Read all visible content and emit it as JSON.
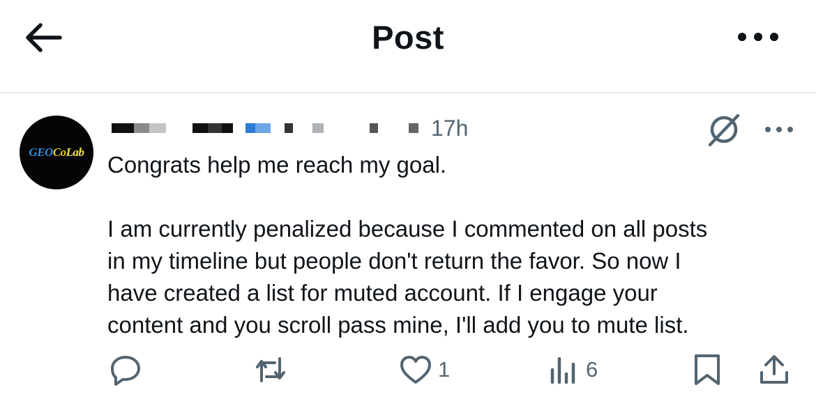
{
  "header": {
    "title": "Post",
    "back_icon": "arrow-left-icon",
    "more_icon": "more-horizontal-icon"
  },
  "post": {
    "avatar": {
      "text_geo": "GEO",
      "text_co": "Co",
      "text_lab": "Lab",
      "background": "#050505"
    },
    "timestamp": "17h",
    "grok_icon": "grok-icon",
    "more_icon": "more-horizontal-icon",
    "body": {
      "line1": "Congrats help me reach my goal.",
      "line2": "I am currently penalized because I commented on all posts",
      "line3": "in my timeline but people don't return the favor. So now I",
      "line4": "have created a list for muted account. If I engage your",
      "line5": "content and you scroll pass mine, I'll add you to mute list."
    },
    "actions": {
      "reply": {
        "icon": "reply-icon",
        "count": ""
      },
      "repost": {
        "icon": "repost-icon",
        "count": ""
      },
      "like": {
        "icon": "heart-icon",
        "count": "1"
      },
      "views": {
        "icon": "views-icon",
        "count": "6"
      },
      "bookmark": {
        "icon": "bookmark-icon"
      },
      "share": {
        "icon": "share-icon"
      }
    }
  },
  "colors": {
    "text": "#0f1419",
    "secondary": "#536471",
    "divider": "#e6e9ec"
  }
}
